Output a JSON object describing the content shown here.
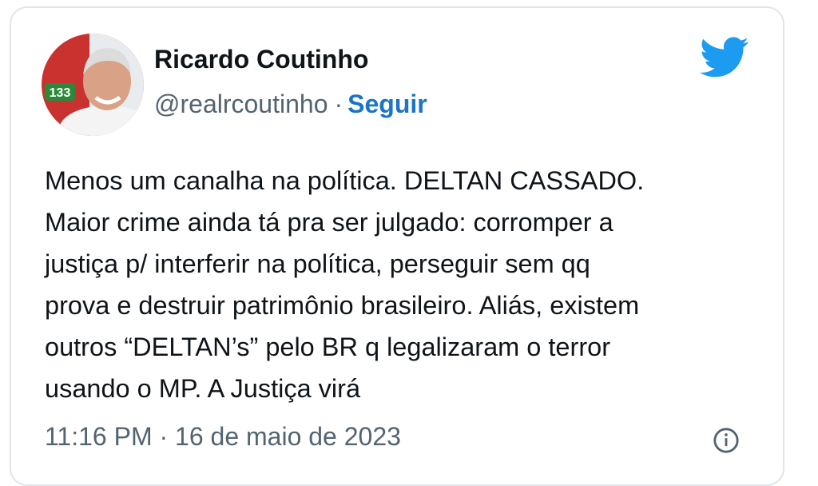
{
  "author": {
    "name": "Ricardo Coutinho",
    "handle": "@realrcoutinho",
    "separator": "·",
    "follow_label": "Seguir",
    "avatar_badge": "133"
  },
  "tweet": {
    "text": "Menos um canalha na política. DELTAN CASSADO.\nMaior crime ainda tá pra ser julgado: corromper a\njustiça p/ interferir na política, perseguir sem qq\nprova e destruir patrimônio brasileiro. Aliás, existem\noutros “DELTAN’s”  pelo BR q legalizaram o terror\nusando o MP. A Justiça virá"
  },
  "meta": {
    "timestamp_partial": "11:16 PM · 16 de maio de 2023"
  },
  "icons": {
    "brand": "twitter-bird-icon",
    "info": "info-icon"
  },
  "colors": {
    "twitter_blue": "#1d9bf0",
    "follow_blue": "#1b74c5",
    "text": "#0f1419",
    "muted": "#536471",
    "border": "#dfe5ea"
  }
}
